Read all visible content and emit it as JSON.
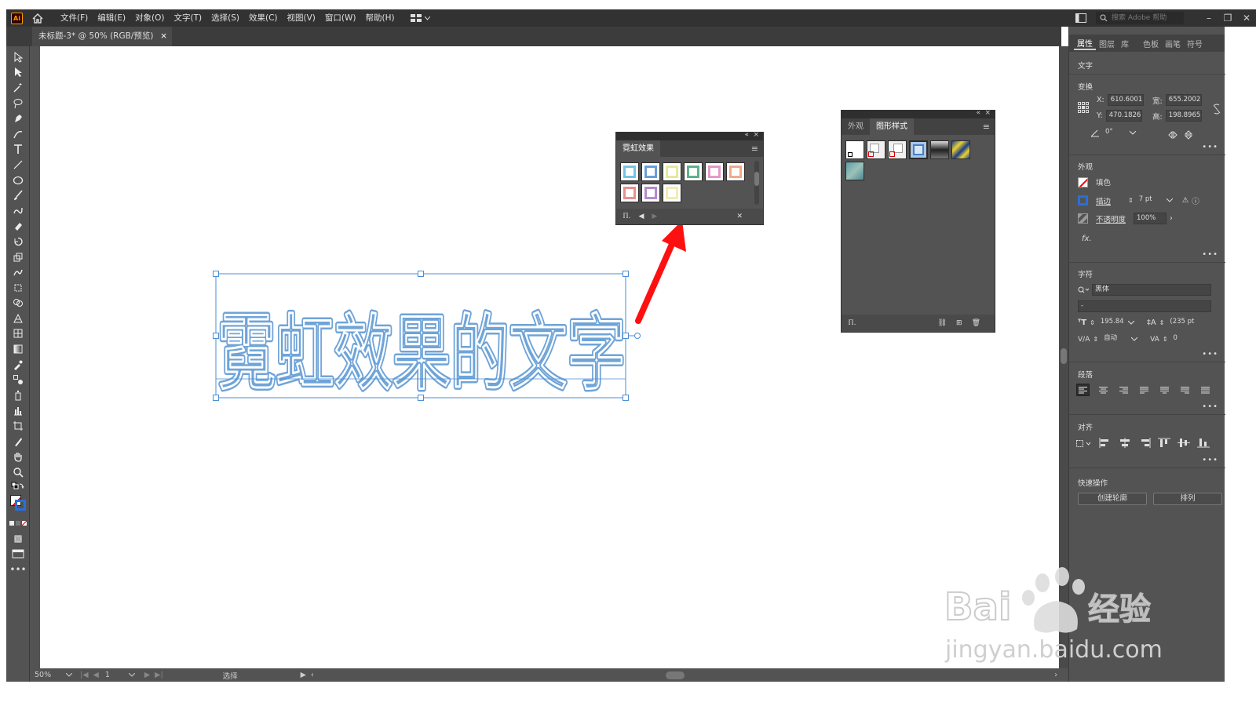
{
  "app": {
    "logo": "Ai"
  },
  "menu": [
    "文件(F)",
    "编辑(E)",
    "对象(O)",
    "文字(T)",
    "选择(S)",
    "效果(C)",
    "视图(V)",
    "窗口(W)",
    "帮助(H)"
  ],
  "search": {
    "placeholder": "搜索 Adobe 帮助"
  },
  "document": {
    "tab_title": "未标题-3* @ 50% (RGB/预览)",
    "close": "×"
  },
  "canvas": {
    "text": "霓虹效果的文字"
  },
  "neon_panel": {
    "title": "霓虹效果",
    "swatches": [
      "#74c6e2",
      "#6a9fd8",
      "#e4ea9c",
      "#5db28d",
      "#e598c8",
      "#f2a98a",
      "#ea8f8f",
      "#b48bd0",
      "#f2ecb4"
    ]
  },
  "graphic_styles_panel": {
    "tabs": [
      "外观",
      "图形样式"
    ]
  },
  "properties": {
    "tabs": [
      "属性",
      "图层",
      "库",
      "色板",
      "画笔",
      "符号"
    ],
    "object_type": "文字",
    "transform": {
      "title": "变换",
      "x_label": "X:",
      "x": "610.6001",
      "y_label": "Y:",
      "y": "470.1826",
      "w_label": "宽:",
      "w": "655.2002",
      "h_label": "高:",
      "h": "198.8965",
      "angle": "0°"
    },
    "appearance": {
      "title": "外观",
      "fill": "填色",
      "stroke": "描边",
      "stroke_weight": "7 pt",
      "opacity_label": "不透明度",
      "opacity": "100%",
      "fx": "fx."
    },
    "character": {
      "title": "字符",
      "font": "黑体",
      "style": "-",
      "size": "195.84",
      "leading": "(235 pt",
      "kerning": "自动",
      "tracking": "0"
    },
    "paragraph": {
      "title": "段落"
    },
    "align": {
      "title": "对齐"
    },
    "quick_actions": {
      "title": "快速操作",
      "create_outlines": "创建轮廓",
      "arrange": "排列"
    }
  },
  "status": {
    "zoom": "50%",
    "page": "1",
    "tool": "选择"
  },
  "watermark": {
    "brand": "Bai",
    "brand2": "经验",
    "url": "jingyan.baidu.com"
  },
  "colors": {
    "neon_stroke": "#6fa4d8",
    "arrow": "#ff1010",
    "selection": "#4a8ed6"
  }
}
